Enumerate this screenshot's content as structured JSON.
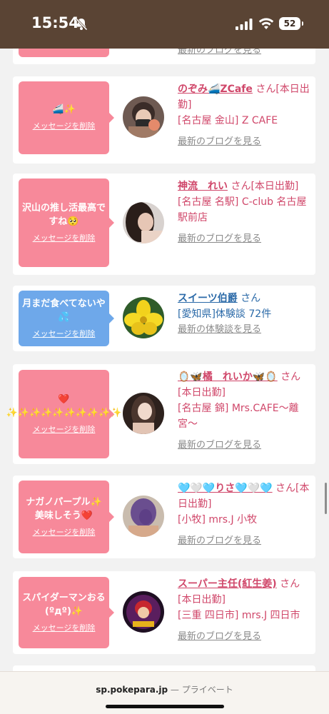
{
  "status_bar": {
    "time": "15:54",
    "battery": "52"
  },
  "cards": [
    {
      "id": "top-partial",
      "bubble_text": "",
      "bubble_color": "#f7899a",
      "delete_label": "",
      "name": "",
      "suffix": "",
      "meta": [],
      "blog_label": "最新のブログを見る",
      "avatar": "none"
    },
    {
      "id": "nozomi",
      "bubble_text": "🚄✨",
      "bubble_color": "#f7899a",
      "delete_label": "メッセージを削除",
      "name": "のぞみ🚄ZCafe",
      "suffix": "さん[本日出勤]",
      "meta": [
        "[名古屋 金山] Z CAFE"
      ],
      "blog_label": "最新のブログを見る",
      "avatar": "masked-girl"
    },
    {
      "id": "kamiru",
      "bubble_text": "沢山の推し活最高ですね🥺",
      "bubble_color": "#f7899a",
      "delete_label": "メッセージを削除",
      "name": "神流　れい",
      "suffix": "さん[本日出勤]",
      "meta": [
        "[名古屋 名駅] C-club 名古屋駅前店"
      ],
      "blog_label": "最新のブログを見る",
      "avatar": "dark-hair-girl"
    },
    {
      "id": "sweets",
      "bubble_text": "月まだ食べてないや💦",
      "bubble_color": "#6ea8ea",
      "delete_label": "メッセージを削除",
      "name": "スイーツ伯爵",
      "suffix": "さん",
      "meta": [
        "[愛知県]体験談 72件"
      ],
      "blog_label": "最新の体験談を見る",
      "avatar": "yellow-flower"
    },
    {
      "id": "tachibana",
      "bubble_text": "❤️ ✨✨✨✨✨✨✨✨✨✨",
      "bubble_color": "#f7899a",
      "delete_label": "メッセージを削除",
      "name": "🪞🦋橘　れいか🦋🪞",
      "suffix": "さん[本日出勤]",
      "meta": [
        "[名古屋 錦] Mrs.CAFE〜離宮〜"
      ],
      "blog_label": "最新のブログを見る",
      "avatar": "long-hair-girl"
    },
    {
      "id": "risa",
      "bubble_text": "ナガノパープル✨美味しそう❤️",
      "bubble_color": "#f7899a",
      "delete_label": "メッセージを削除",
      "name": "🩵🤍🩵りさ🩵🤍🩵",
      "suffix": "さん[本日出勤]",
      "meta": [
        "[小牧] mrs.J 小牧"
      ],
      "blog_label": "最新のブログを見る",
      "avatar": "purple-hair-girl"
    },
    {
      "id": "super-shunin",
      "bubble_text": "スパイダーマンおる(ºдº)✨",
      "bubble_color": "#f7899a",
      "delete_label": "メッセージを削除",
      "name": "スーパー主任(紅生姜)",
      "suffix": "さん[本日出勤]",
      "meta": [
        "[三重 四日市] mrs.J 四日市"
      ],
      "blog_label": "最新のブログを見る",
      "avatar": "anime-badge"
    }
  ],
  "url_bar": {
    "domain": "sp.pokepara.jp",
    "separator": " — ",
    "mode": "プライベート"
  }
}
